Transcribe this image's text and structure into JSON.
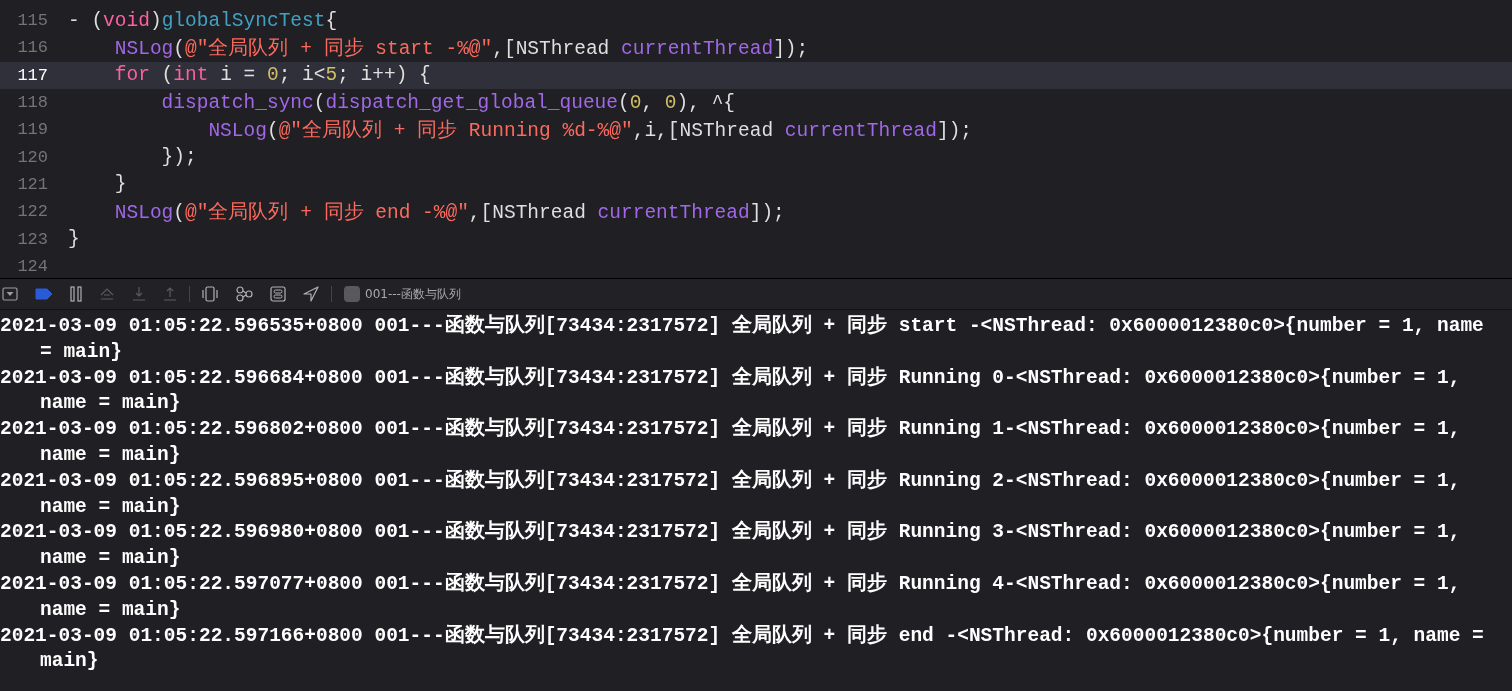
{
  "editor": {
    "lines": [
      {
        "number": "115",
        "current": false,
        "tokens": [
          {
            "kind": "plain",
            "text": "- ("
          },
          {
            "kind": "keyword",
            "text": "void"
          },
          {
            "kind": "plain",
            "text": ")"
          },
          {
            "kind": "decl",
            "text": "globalSyncTest"
          },
          {
            "kind": "plain",
            "text": "{"
          }
        ]
      },
      {
        "number": "116",
        "current": false,
        "tokens": [
          {
            "kind": "call",
            "text": "    NSLog"
          },
          {
            "kind": "plain",
            "text": "("
          },
          {
            "kind": "string",
            "text": "@\"全局队列 + 同步 start -%@\""
          },
          {
            "kind": "plain",
            "text": ",[NSThread "
          },
          {
            "kind": "call",
            "text": "currentThread"
          },
          {
            "kind": "plain",
            "text": "]);"
          }
        ]
      },
      {
        "number": "117",
        "current": true,
        "tokens": [
          {
            "kind": "keyword",
            "text": "    for"
          },
          {
            "kind": "plain",
            "text": " ("
          },
          {
            "kind": "keyword",
            "text": "int"
          },
          {
            "kind": "plain",
            "text": " i = "
          },
          {
            "kind": "number",
            "text": "0"
          },
          {
            "kind": "plain",
            "text": "; i<"
          },
          {
            "kind": "number",
            "text": "5"
          },
          {
            "kind": "plain",
            "text": "; i++) {"
          }
        ]
      },
      {
        "number": "118",
        "current": false,
        "tokens": [
          {
            "kind": "call",
            "text": "        dispatch_sync"
          },
          {
            "kind": "plain",
            "text": "("
          },
          {
            "kind": "call",
            "text": "dispatch_get_global_queue"
          },
          {
            "kind": "plain",
            "text": "("
          },
          {
            "kind": "number",
            "text": "0"
          },
          {
            "kind": "plain",
            "text": ", "
          },
          {
            "kind": "number",
            "text": "0"
          },
          {
            "kind": "plain",
            "text": "), ^{"
          }
        ]
      },
      {
        "number": "119",
        "current": false,
        "tokens": [
          {
            "kind": "call",
            "text": "            NSLog"
          },
          {
            "kind": "plain",
            "text": "("
          },
          {
            "kind": "string",
            "text": "@\"全局队列 + 同步 Running %d-%@\""
          },
          {
            "kind": "plain",
            "text": ",i,[NSThread "
          },
          {
            "kind": "call",
            "text": "currentThread"
          },
          {
            "kind": "plain",
            "text": "]);"
          }
        ]
      },
      {
        "number": "120",
        "current": false,
        "tokens": [
          {
            "kind": "plain",
            "text": "        });"
          }
        ]
      },
      {
        "number": "121",
        "current": false,
        "tokens": [
          {
            "kind": "plain",
            "text": "    }"
          }
        ]
      },
      {
        "number": "122",
        "current": false,
        "tokens": [
          {
            "kind": "call",
            "text": "    NSLog"
          },
          {
            "kind": "plain",
            "text": "("
          },
          {
            "kind": "string",
            "text": "@\"全局队列 + 同步 end -%@\""
          },
          {
            "kind": "plain",
            "text": ",[NSThread "
          },
          {
            "kind": "call",
            "text": "currentThread"
          },
          {
            "kind": "plain",
            "text": "]);"
          }
        ]
      },
      {
        "number": "123",
        "current": false,
        "tokens": [
          {
            "kind": "plain",
            "text": "}"
          }
        ]
      },
      {
        "number": "124",
        "current": false
      }
    ]
  },
  "debug_bar": {
    "breakpoints_active": true,
    "target": "001---函数与队列"
  },
  "console": {
    "entries": [
      {
        "lines": [
          "2021-03-09 01:05:22.596535+0800 001---函数与队列[73434:2317572] 全局队列 + 同步 start -<NSThread: 0x6000012380c0>{number = 1, name",
          "= main}"
        ]
      },
      {
        "lines": [
          "2021-03-09 01:05:22.596684+0800 001---函数与队列[73434:2317572] 全局队列 + 同步 Running 0-<NSThread: 0x6000012380c0>{number = 1,",
          "name = main}"
        ]
      },
      {
        "lines": [
          "2021-03-09 01:05:22.596802+0800 001---函数与队列[73434:2317572] 全局队列 + 同步 Running 1-<NSThread: 0x6000012380c0>{number = 1,",
          "name = main}"
        ]
      },
      {
        "lines": [
          "2021-03-09 01:05:22.596895+0800 001---函数与队列[73434:2317572] 全局队列 + 同步 Running 2-<NSThread: 0x6000012380c0>{number = 1,",
          "name = main}"
        ]
      },
      {
        "lines": [
          "2021-03-09 01:05:22.596980+0800 001---函数与队列[73434:2317572] 全局队列 + 同步 Running 3-<NSThread: 0x6000012380c0>{number = 1,",
          "name = main}"
        ]
      },
      {
        "lines": [
          "2021-03-09 01:05:22.597077+0800 001---函数与队列[73434:2317572] 全局队列 + 同步 Running 4-<NSThread: 0x6000012380c0>{number = 1,",
          "name = main}"
        ]
      },
      {
        "lines": [
          "2021-03-09 01:05:22.597166+0800 001---函数与队列[73434:2317572] 全局队列 + 同步 end -<NSThread: 0x6000012380c0>{number = 1, name =",
          "main}"
        ]
      }
    ]
  }
}
